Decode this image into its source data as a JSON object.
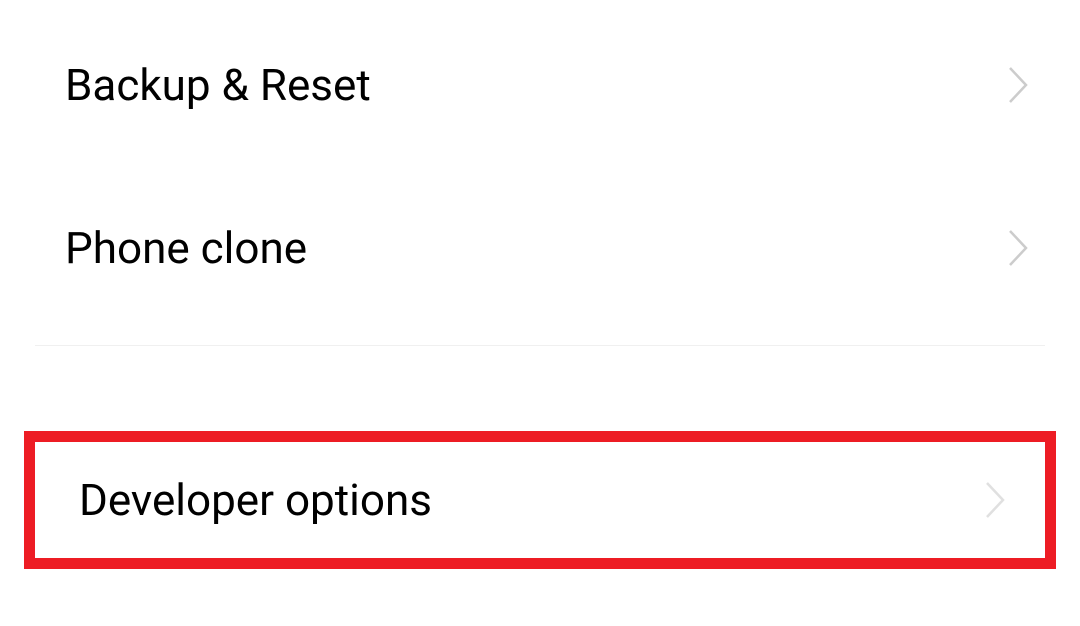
{
  "settings": {
    "items": [
      {
        "label": "Backup & Reset"
      },
      {
        "label": "Phone clone"
      },
      {
        "label": "Developer options"
      }
    ]
  }
}
